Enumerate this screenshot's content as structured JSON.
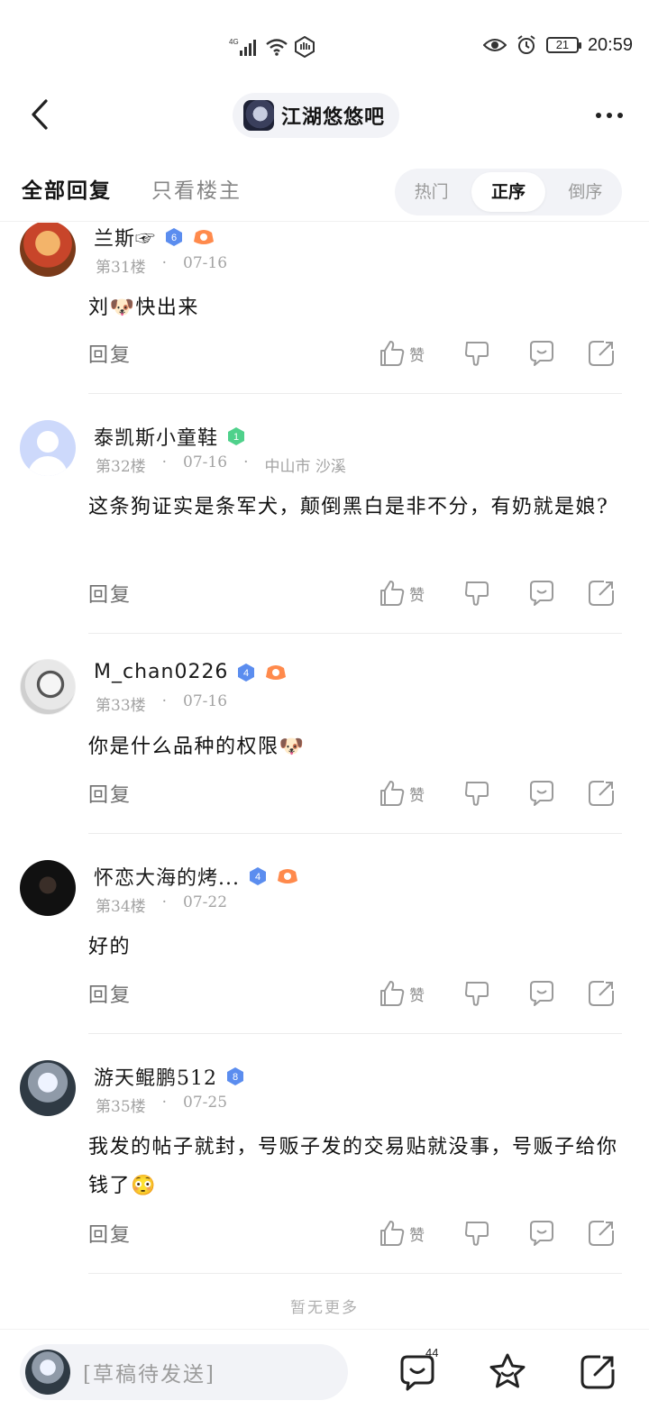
{
  "status_bar": {
    "network": "4G",
    "battery": "21",
    "time": "20:59"
  },
  "nav": {
    "forum_name": "江湖悠悠吧"
  },
  "tabs": {
    "all_replies": "全部回复",
    "op_only": "只看楼主",
    "sort_hot": "热门",
    "sort_asc": "正序",
    "sort_desc": "倒序",
    "active_sort": "正序"
  },
  "posts": [
    {
      "username": "兰斯☞",
      "level": "6",
      "floor": "第31楼",
      "date": "07-16",
      "location": "",
      "content": "刘🐶快出来"
    },
    {
      "username": "泰凯斯小童鞋",
      "level": "1",
      "floor": "第32楼",
      "date": "07-16",
      "location": "中山市 沙溪",
      "content": "这条狗证实是条军犬，颠倒黑白是非不分，有奶就是娘?"
    },
    {
      "username": "M_chan0226",
      "level": "4",
      "floor": "第33楼",
      "date": "07-16",
      "location": "",
      "content": "你是什么品种的权限🐶"
    },
    {
      "username": "怀恋大海的烤...",
      "level": "4",
      "floor": "第34楼",
      "date": "07-22",
      "location": "",
      "content": "好的"
    },
    {
      "username": "游天鲲鹏512",
      "level": "8",
      "floor": "第35楼",
      "date": "07-25",
      "location": "",
      "content": "我发的帖子就封，号贩子发的交易贴就没事，号贩子给你钱了😳"
    }
  ],
  "actions": {
    "reply": "回复",
    "like": "赞"
  },
  "footer_note": "暂无更多",
  "bottom_bar": {
    "draft_placeholder": "[草稿待发送]",
    "comment_count": "44"
  },
  "colors": {
    "level_badge_blue": "#5b8def",
    "level_badge_green": "#4fd18b",
    "fan_badge_orange": "#ff8a4c",
    "sort_bg": "#f2f3f7"
  }
}
